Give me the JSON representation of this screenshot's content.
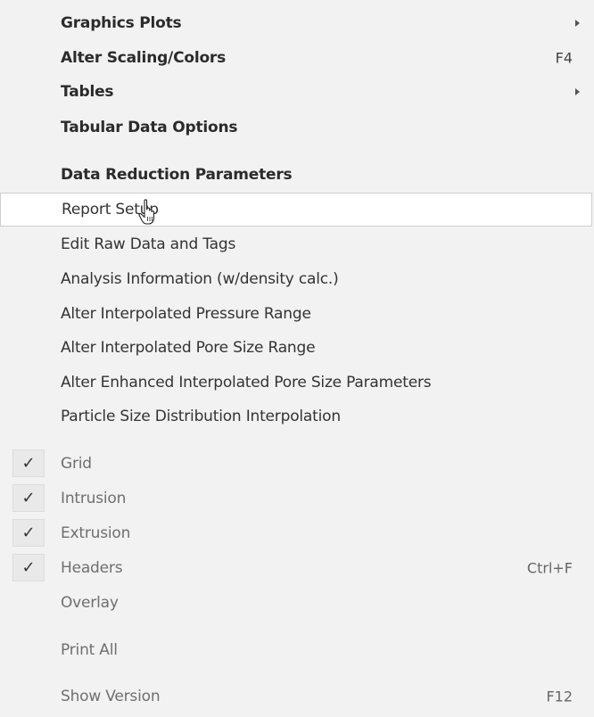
{
  "menu": {
    "items": [
      {
        "label": "Graphics Plots",
        "shortcut": "",
        "submenu": true,
        "checked": false
      },
      {
        "label": "Alter Scaling/Colors",
        "shortcut": "F4",
        "submenu": false,
        "checked": false
      },
      {
        "label": "Tables",
        "shortcut": "",
        "submenu": true,
        "checked": false
      },
      {
        "label": "Tabular Data Options",
        "shortcut": "",
        "submenu": false,
        "checked": false
      },
      {
        "label": "Data Reduction Parameters",
        "shortcut": "",
        "submenu": false,
        "checked": false
      },
      {
        "label": "Report Setup",
        "shortcut": "",
        "submenu": false,
        "checked": false,
        "hovered": true
      },
      {
        "label": "Edit Raw Data and Tags",
        "shortcut": "",
        "submenu": false,
        "checked": false
      },
      {
        "label": "Analysis Information (w/density calc.)",
        "shortcut": "",
        "submenu": false,
        "checked": false
      },
      {
        "label": "Alter Interpolated Pressure Range",
        "shortcut": "",
        "submenu": false,
        "checked": false
      },
      {
        "label": "Alter Interpolated Pore Size Range",
        "shortcut": "",
        "submenu": false,
        "checked": false
      },
      {
        "label": "Alter Enhanced Interpolated Pore Size Parameters",
        "shortcut": "",
        "submenu": false,
        "checked": false
      },
      {
        "label": "Particle Size Distribution Interpolation",
        "shortcut": "",
        "submenu": false,
        "checked": false
      },
      {
        "label": "Grid",
        "shortcut": "",
        "submenu": false,
        "checked": true
      },
      {
        "label": "Intrusion",
        "shortcut": "",
        "submenu": false,
        "checked": true
      },
      {
        "label": "Extrusion",
        "shortcut": "",
        "submenu": false,
        "checked": true
      },
      {
        "label": "Headers",
        "shortcut": "Ctrl+F",
        "submenu": false,
        "checked": true
      },
      {
        "label": "Overlay",
        "shortcut": "",
        "submenu": false,
        "checked": false
      },
      {
        "label": "Print All",
        "shortcut": "",
        "submenu": false,
        "checked": false
      },
      {
        "label": "Show Version",
        "shortcut": "F12",
        "submenu": false,
        "checked": false
      }
    ],
    "check_glyph": "✓",
    "colors": {
      "background": "#f2f2f2",
      "hover_background": "#ffffff",
      "hover_border": "#cfcfcf",
      "text": "#2b2b2b",
      "muted_text": "#6f6f6f"
    }
  }
}
